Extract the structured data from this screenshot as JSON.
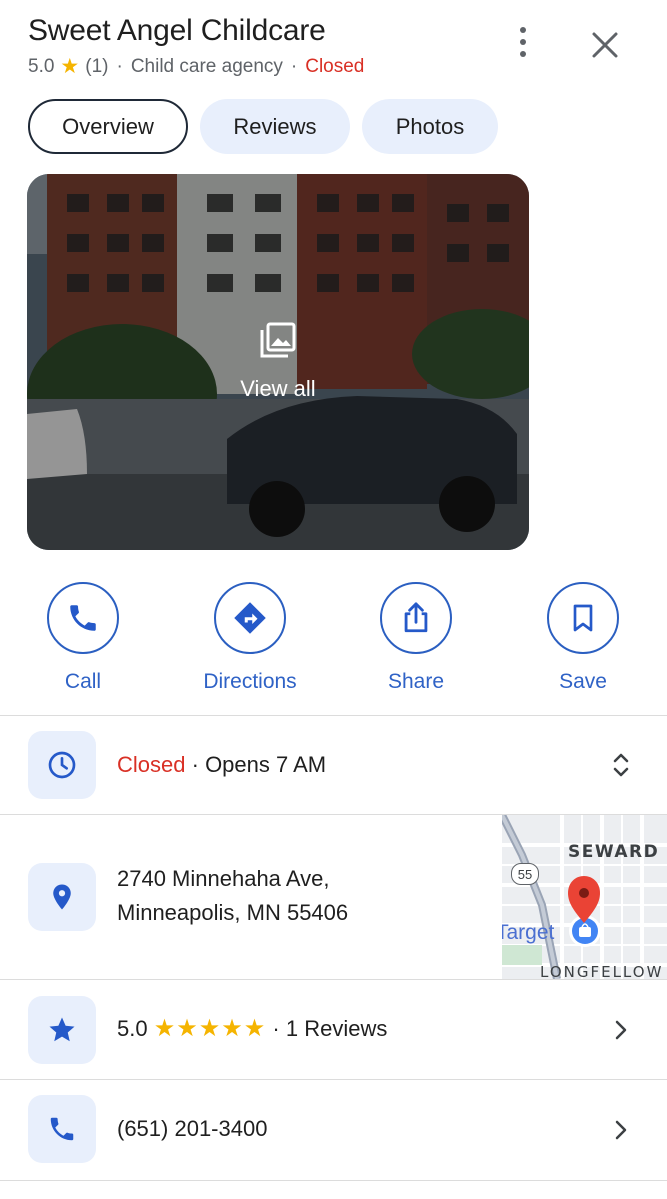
{
  "place": {
    "name": "Sweet Angel Childcare",
    "rating": "5.0",
    "rating_star": "★",
    "review_count": "(1)",
    "separator": "·",
    "category": "Child care agency",
    "status": "Closed"
  },
  "header": {
    "more_icon": "more-vert-icon",
    "close_icon": "close-icon"
  },
  "tabs": [
    {
      "label": "Overview",
      "active": true
    },
    {
      "label": "Reviews",
      "active": false
    },
    {
      "label": "Photos",
      "active": false
    }
  ],
  "photo": {
    "view_all_label": "View all",
    "icon": "photo-library-icon"
  },
  "actions": [
    {
      "label": "Call",
      "icon": "phone-icon"
    },
    {
      "label": "Directions",
      "icon": "directions-icon"
    },
    {
      "label": "Share",
      "icon": "share-icon"
    },
    {
      "label": "Save",
      "icon": "bookmark-icon"
    }
  ],
  "hours": {
    "status": "Closed",
    "separator": "·",
    "next": "Opens 7 AM",
    "icon": "clock-icon",
    "expand_icon": "unfold-icon"
  },
  "address": {
    "line1": "2740 Minnehaha Ave,",
    "line2": "Minneapolis, MN 55406",
    "icon": "location-pin-icon",
    "map": {
      "label_seward": "SEWARD",
      "label_route": "55",
      "label_target": "Target",
      "label_longfellow": "LONGFELLOW"
    }
  },
  "reviews_row": {
    "rating": "5.0",
    "stars": "★★★★★",
    "separator": "·",
    "count_label": "1 Reviews",
    "icon": "star-icon"
  },
  "phone_row": {
    "number": "(651) 201-3400",
    "icon": "phone-icon"
  },
  "colors": {
    "accent_blue": "#2f62c6",
    "closed_red": "#d93025",
    "star_yellow": "#f5b400",
    "chip_bg": "#e8effc"
  }
}
